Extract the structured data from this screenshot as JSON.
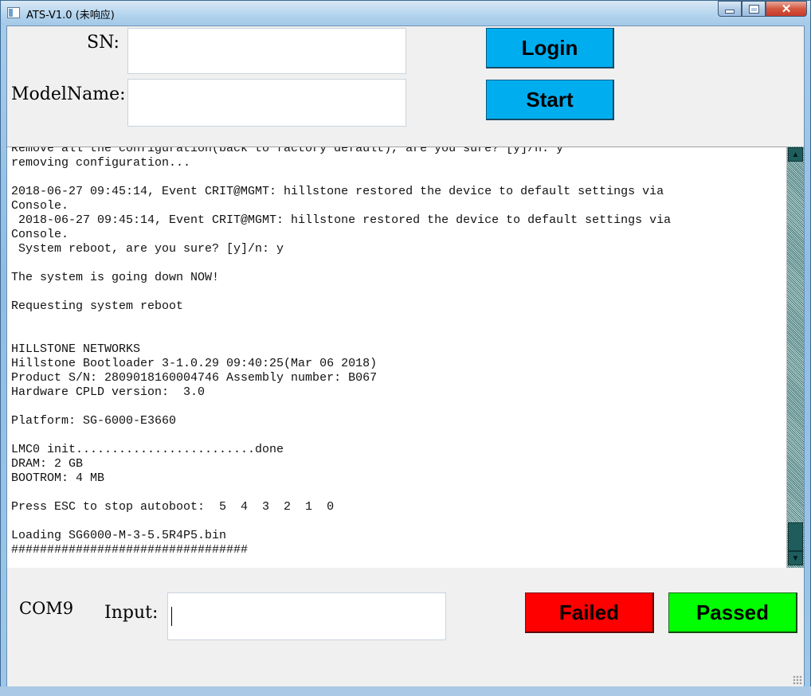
{
  "window": {
    "title": "ATS-V1.0 (未响应)",
    "close_label": "✕"
  },
  "form": {
    "sn_label": "SN:",
    "sn_value": "",
    "model_label": "ModelName:",
    "model_value": "",
    "login_label": "Login",
    "start_label": "Start"
  },
  "console": {
    "lines": [
      "Remove all the configuration(back to factory default), are you sure? [y]/n: y",
      "removing configuration...",
      "",
      "2018-06-27 09:45:14, Event CRIT@MGMT: hillstone restored the device to default settings via",
      "Console.",
      " 2018-06-27 09:45:14, Event CRIT@MGMT: hillstone restored the device to default settings via",
      "Console.",
      " System reboot, are you sure? [y]/n: y",
      "",
      "The system is going down NOW!",
      "",
      "Requesting system reboot",
      "",
      "",
      "HILLSTONE NETWORKS",
      "Hillstone Bootloader 3-1.0.29 09:40:25(Mar 06 2018)",
      "Product S/N: 2809018160004746 Assembly number: B067",
      "Hardware CPLD version:  3.0",
      "",
      "Platform: SG-6000-E3660",
      "",
      "LMC0 init.........................done",
      "DRAM: 2 GB",
      "BOOTROM: 4 MB",
      "",
      "Press ESC to stop autoboot:  5  4  3  2  1  0",
      "",
      "Loading SG6000-M-3-5.5R4P5.bin",
      "#################################"
    ]
  },
  "bottom": {
    "port_label": "COM9",
    "input_label": "Input:",
    "input_value": "",
    "failed_label": "Failed",
    "passed_label": "Passed"
  },
  "colors": {
    "login_button": "#00aef0",
    "failed_button": "#ff0000",
    "passed_button": "#00ff00",
    "scrollbar": "#1f5d5d"
  }
}
